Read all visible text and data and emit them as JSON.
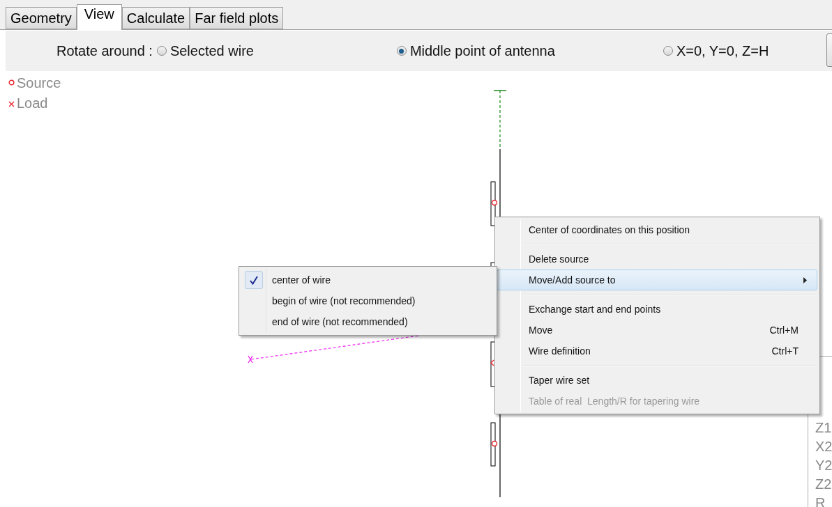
{
  "tabs": [
    {
      "label": "Geometry",
      "selected": false
    },
    {
      "label": "View",
      "selected": true
    },
    {
      "label": "Calculate",
      "selected": false
    },
    {
      "label": "Far field plots",
      "selected": false
    }
  ],
  "toolbar": {
    "label": "Rotate around :",
    "options": [
      {
        "label": "Selected wire",
        "selected": false
      },
      {
        "label": "Middle point of antenna",
        "selected": true
      },
      {
        "label": "X=0, Y=0, Z=H",
        "selected": false
      }
    ]
  },
  "legend": [
    {
      "kind": "source",
      "label": "Source"
    },
    {
      "kind": "load",
      "label": "Load"
    }
  ],
  "context_menu": {
    "items": [
      {
        "kind": "item",
        "label": "Center of coordinates on this position",
        "selected": false,
        "disabled": false
      },
      {
        "kind": "separator"
      },
      {
        "kind": "item",
        "label": "Delete source",
        "selected": false,
        "disabled": false
      },
      {
        "kind": "submenu",
        "label": "Move/Add source to",
        "selected": true,
        "disabled": false
      },
      {
        "kind": "separator"
      },
      {
        "kind": "item",
        "label": "Exchange start and end points",
        "selected": false,
        "disabled": false
      },
      {
        "kind": "item",
        "label": "Move",
        "shortcut": "Ctrl+M",
        "selected": false,
        "disabled": false
      },
      {
        "kind": "item",
        "label": "Wire definition",
        "shortcut": "Ctrl+T",
        "selected": false,
        "disabled": false
      },
      {
        "kind": "separator"
      },
      {
        "kind": "item",
        "label": "Taper wire set",
        "selected": false,
        "disabled": false
      },
      {
        "kind": "item",
        "label": "Table of real  Length/R for tapering wire",
        "selected": false,
        "disabled": true
      }
    ]
  },
  "submenu": {
    "items": [
      {
        "label": "center of wire",
        "checked": true
      },
      {
        "label": "begin of wire (not recommended)",
        "checked": false
      },
      {
        "label": "end of wire (not recommended)",
        "checked": false
      }
    ]
  },
  "side_panel": {
    "lines": [
      "Z1",
      "X2",
      "Y2",
      "Z2",
      "R"
    ]
  }
}
